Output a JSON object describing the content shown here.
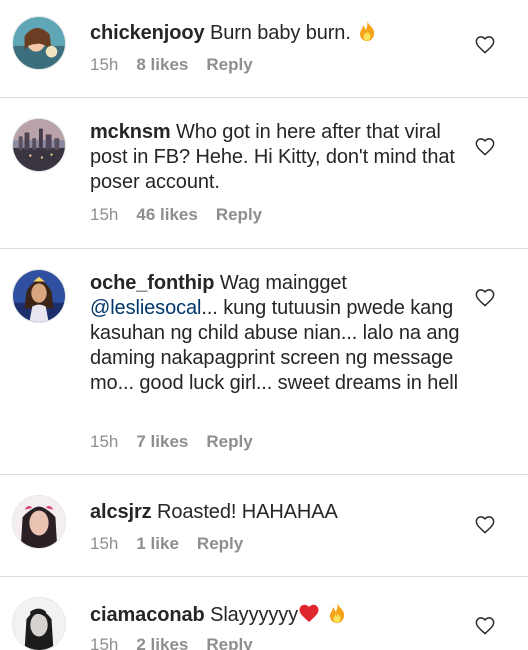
{
  "comments": [
    {
      "username": "chickenjooy",
      "text": "Burn baby burn.",
      "emoji": [
        "fire-emoji"
      ],
      "time": "15h",
      "likes": "8 likes",
      "reply": "Reply"
    },
    {
      "username": "mcknsm",
      "text": "Who got in here after that viral post in FB? Hehe. Hi Kitty, don't mind that poser account.",
      "time": "15h",
      "likes": "46 likes",
      "reply": "Reply"
    },
    {
      "username": "oche_fonthip",
      "text_before": "Wag maingget",
      "mention": "@lesliesocal",
      "text_after": "... kung tutuusin pwede kang kasuhan ng child abuse nian... lalo na ang daming nakapagprint screen ng message mo... good luck girl... sweet dreams in hell",
      "time": "15h",
      "likes": "7 likes",
      "reply": "Reply"
    },
    {
      "username": "alcsjrz",
      "text": "Roasted! HAHAHAA",
      "time": "15h",
      "likes": "1 like",
      "reply": "Reply"
    },
    {
      "username": "ciamaconab",
      "text": "Slayyyyyy",
      "emoji": [
        "red-heart-emoji",
        "fire-emoji"
      ],
      "time": "15h",
      "likes": "2 likes",
      "reply": "Reply"
    }
  ],
  "icons": {
    "like": "heart-outline-icon",
    "fire": "fire-emoji",
    "heart": "red-heart-emoji"
  },
  "colors": {
    "text": "#262626",
    "meta": "#8e8e8e",
    "mention": "#00376b",
    "divider": "#dbdbdb",
    "red_heart": "#e0262d",
    "fire": "#f7a21b"
  }
}
